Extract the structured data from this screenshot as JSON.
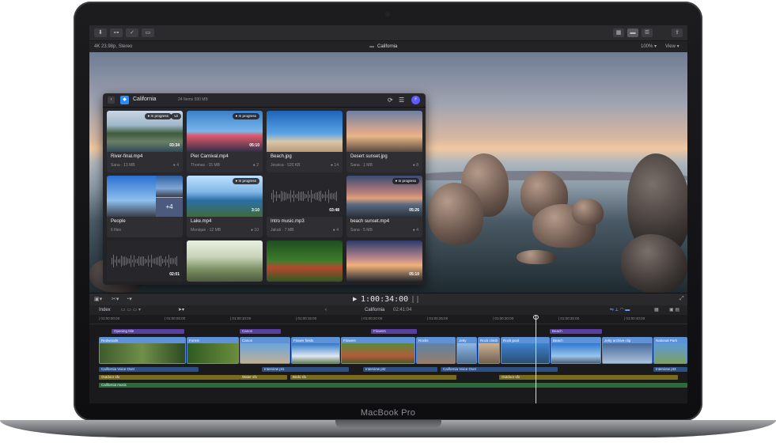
{
  "device": {
    "brand": "MacBook Pro"
  },
  "app": {
    "project_title": "California",
    "format": "4K 23.98p, Stereo",
    "zoom": "100%",
    "view_menu": "View",
    "timecode": "1:00:34:00"
  },
  "photos": {
    "album": "California",
    "album_meta": "24 Items 590 MB",
    "badge_in_progress": "In progress",
    "badge_v2": "v2",
    "items": [
      {
        "name": "River-final.mp4",
        "author": "Sana",
        "size": "13 MB",
        "count": "4",
        "duration": "03:34"
      },
      {
        "name": "Pier Carnival.mp4",
        "author": "Thomas",
        "size": "15 MB",
        "count": "2",
        "duration": "05:10"
      },
      {
        "name": "Beach.jpg",
        "author": "Jessica",
        "size": "520 KB",
        "count": "14",
        "duration": ""
      },
      {
        "name": "Desert sunset.jpg",
        "author": "Sana",
        "size": "1 MB",
        "count": "8",
        "duration": ""
      },
      {
        "name": "People",
        "author": "6 files",
        "size": "",
        "count": "",
        "duration": "",
        "extra": "+4"
      },
      {
        "name": "Lake.mp4",
        "author": "Monique",
        "size": "12 MB",
        "count": "10",
        "duration": "3:10"
      },
      {
        "name": "Intro music.mp3",
        "author": "Jakub",
        "size": "7 MB",
        "count": "4",
        "duration": "03:48"
      },
      {
        "name": "beach sunset.mp4",
        "author": "Sana",
        "size": "5 MB",
        "count": "4",
        "duration": "05:26"
      },
      {
        "name": "",
        "author": "",
        "size": "",
        "count": "",
        "duration": "02:01"
      },
      {
        "name": "",
        "author": "",
        "size": "",
        "count": "",
        "duration": ""
      },
      {
        "name": "",
        "author": "",
        "size": "",
        "count": "",
        "duration": ""
      },
      {
        "name": "",
        "author": "",
        "size": "",
        "count": "",
        "duration": "05:10"
      }
    ]
  },
  "timeline": {
    "index_label": "Index",
    "project": "California",
    "duration": "02:41:04",
    "ruler": [
      "01:00:00:00",
      "01:00:05:00",
      "01:00:10:00",
      "01:00:15:00",
      "01:00:20:00",
      "01:00:25:00",
      "01:00:30:00",
      "01:00:35:00",
      "01:00:40:00"
    ],
    "connected": [
      {
        "label": "Opening title"
      },
      {
        "label": "Canon"
      },
      {
        "label": "Flowers"
      },
      {
        "label": "Beach"
      }
    ],
    "clips": [
      "Redwoods",
      "Forest",
      "Canon",
      "Flower fields",
      "Flowers",
      "Rocks",
      "Jetty",
      "Rock climb",
      "Rock pool",
      "Beach",
      "Jetty archive clip",
      "National Park"
    ],
    "audio": [
      {
        "label": "California Voice Over"
      },
      {
        "label": "Interview pt1"
      },
      {
        "label": "Interview pt2"
      },
      {
        "label": "California Voice Over"
      },
      {
        "label": "Interview pt3"
      },
      {
        "label": "Outdoor sfx"
      },
      {
        "label": "Water sfx"
      },
      {
        "label": "Birds sfx"
      },
      {
        "label": "Outdoor sfx"
      },
      {
        "label": "California music"
      }
    ]
  }
}
